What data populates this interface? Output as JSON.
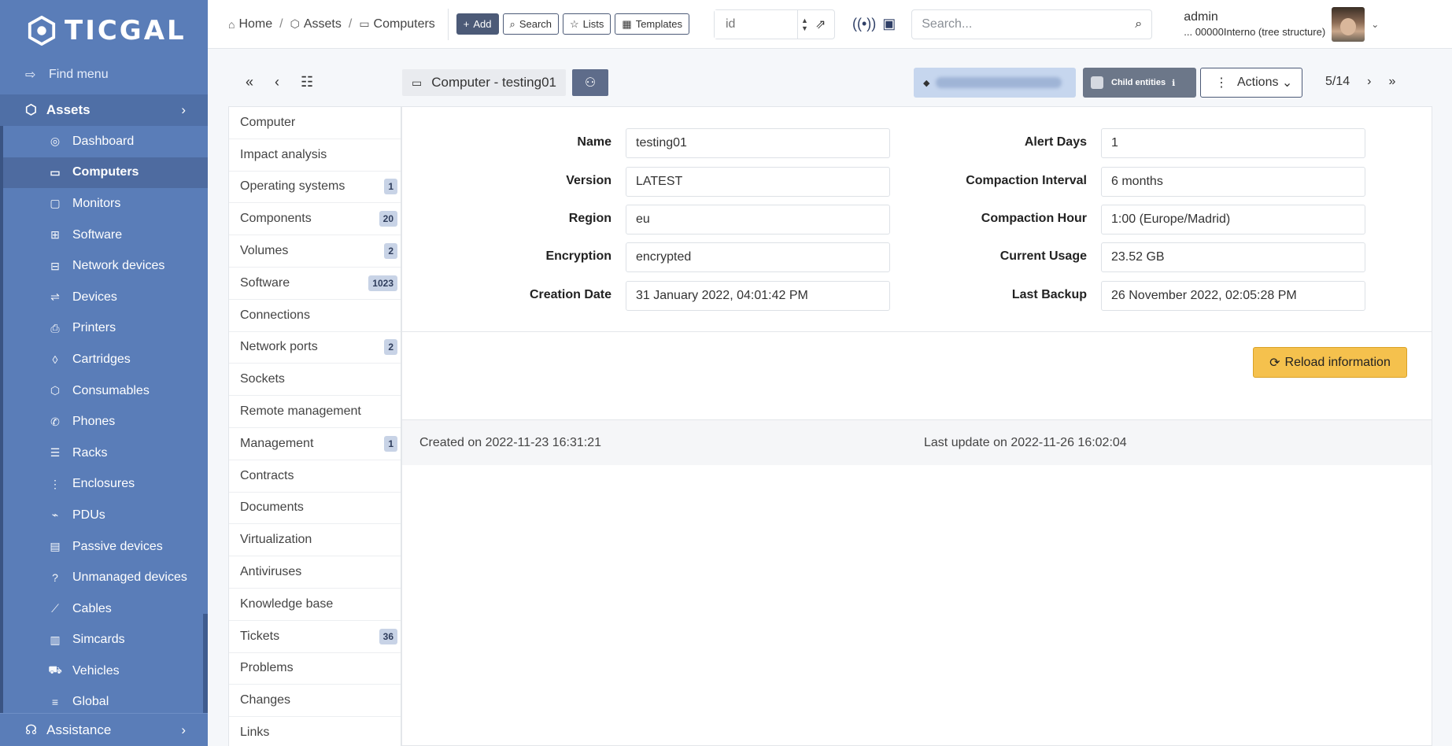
{
  "brand": {
    "name": "TICGAL"
  },
  "sidebar": {
    "find_menu": "Find menu",
    "section": "Assets",
    "items": [
      {
        "label": "Dashboard",
        "icon": "gauge-icon"
      },
      {
        "label": "Computers",
        "icon": "laptop-icon",
        "active": true
      },
      {
        "label": "Monitors",
        "icon": "monitor-icon"
      },
      {
        "label": "Software",
        "icon": "apps-icon"
      },
      {
        "label": "Network devices",
        "icon": "network-icon"
      },
      {
        "label": "Devices",
        "icon": "usb-icon"
      },
      {
        "label": "Printers",
        "icon": "printer-icon"
      },
      {
        "label": "Cartridges",
        "icon": "droplet-icon"
      },
      {
        "label": "Consumables",
        "icon": "package-icon"
      },
      {
        "label": "Phones",
        "icon": "phone-icon"
      },
      {
        "label": "Racks",
        "icon": "server-icon"
      },
      {
        "label": "Enclosures",
        "icon": "columns-icon"
      },
      {
        "label": "PDUs",
        "icon": "plug-icon"
      },
      {
        "label": "Passive devices",
        "icon": "box-icon"
      },
      {
        "label": "Unmanaged devices",
        "icon": "question-icon"
      },
      {
        "label": "Cables",
        "icon": "cable-icon"
      },
      {
        "label": "Simcards",
        "icon": "simcard-icon"
      },
      {
        "label": "Vehicles",
        "icon": "car-icon"
      },
      {
        "label": "Global",
        "icon": "list-icon"
      }
    ],
    "assistance": "Assistance"
  },
  "topbar": {
    "breadcrumb": [
      "Home",
      "Assets",
      "Computers"
    ],
    "buttons": {
      "add": "Add",
      "search": "Search",
      "lists": "Lists",
      "templates": "Templates"
    },
    "id_placeholder": "id",
    "search_placeholder": "Search...",
    "user": {
      "name": "admin",
      "entity": "... 00000Interno (tree structure)"
    }
  },
  "item": {
    "title": "Computer - testing01",
    "child_entities": "Child entities",
    "actions": "Actions",
    "pager": "5/14"
  },
  "tabs": [
    {
      "label": "Computer",
      "badge": ""
    },
    {
      "label": "Impact analysis",
      "badge": ""
    },
    {
      "label": "Operating systems",
      "badge": "1"
    },
    {
      "label": "Components",
      "badge": "20"
    },
    {
      "label": "Volumes",
      "badge": "2"
    },
    {
      "label": "Software",
      "badge": "1023"
    },
    {
      "label": "Connections",
      "badge": ""
    },
    {
      "label": "Network ports",
      "badge": "2"
    },
    {
      "label": "Sockets",
      "badge": ""
    },
    {
      "label": "Remote management",
      "badge": ""
    },
    {
      "label": "Management",
      "badge": "1"
    },
    {
      "label": "Contracts",
      "badge": ""
    },
    {
      "label": "Documents",
      "badge": ""
    },
    {
      "label": "Virtualization",
      "badge": ""
    },
    {
      "label": "Antiviruses",
      "badge": ""
    },
    {
      "label": "Knowledge base",
      "badge": ""
    },
    {
      "label": "Tickets",
      "badge": "36"
    },
    {
      "label": "Problems",
      "badge": ""
    },
    {
      "label": "Changes",
      "badge": ""
    },
    {
      "label": "Links",
      "badge": ""
    }
  ],
  "form": {
    "left": [
      {
        "label": "Name",
        "value": "testing01"
      },
      {
        "label": "Version",
        "value": "LATEST"
      },
      {
        "label": "Region",
        "value": "eu"
      },
      {
        "label": "Encryption",
        "value": "encrypted"
      },
      {
        "label": "Creation Date",
        "value": "31 January 2022, 04:01:42 PM"
      }
    ],
    "right": [
      {
        "label": "Alert Days",
        "value": "1"
      },
      {
        "label": "Compaction Interval",
        "value": "6 months"
      },
      {
        "label": "Compaction Hour",
        "value": "1:00 (Europe/Madrid)"
      },
      {
        "label": "Current Usage",
        "value": "23.52 GB"
      },
      {
        "label": "Last Backup",
        "value": "26 November 2022, 02:05:28 PM"
      }
    ],
    "reload": "Reload information"
  },
  "footer": {
    "created": "Created on 2022-11-23 16:31:21",
    "updated": "Last update on 2022-11-26 16:02:04"
  }
}
